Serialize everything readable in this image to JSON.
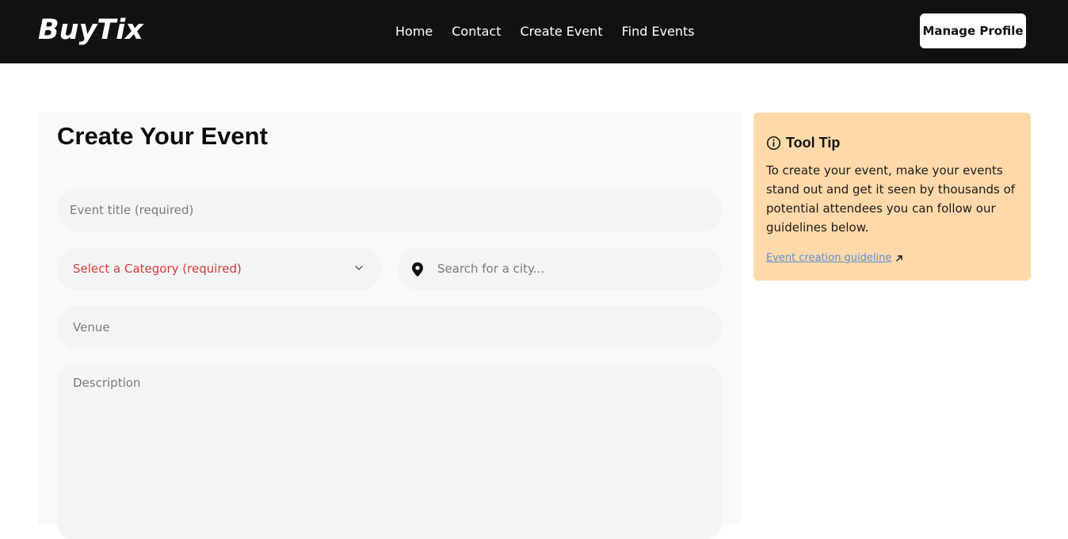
{
  "header": {
    "logo": "BuyTix",
    "nav": [
      "Home",
      "Contact",
      "Create Event",
      "Find Events"
    ],
    "manage_profile": "Manage Profile"
  },
  "form": {
    "title": "Create Your Event",
    "event_title_placeholder": "Event title (required)",
    "category_label": "Select a Category (required)",
    "city_placeholder": "Search for a city...",
    "venue_placeholder": "Venue",
    "description_placeholder": "Description"
  },
  "tooltip": {
    "title": "Tool Tip",
    "body": "To create your event, make your events stand out and get it seen by thousands of potential attendees you can follow our guidelines below.",
    "link": "Event creation guideline"
  },
  "icons": {
    "info": "info-icon",
    "pin": "location-pin-icon",
    "chevron": "chevron-down-icon",
    "external": "external-link-icon"
  },
  "colors": {
    "header_bg": "#111111",
    "tooltip_bg": "#ffd9aa",
    "category_text": "#d33b3b",
    "link": "#5b8fd1"
  }
}
